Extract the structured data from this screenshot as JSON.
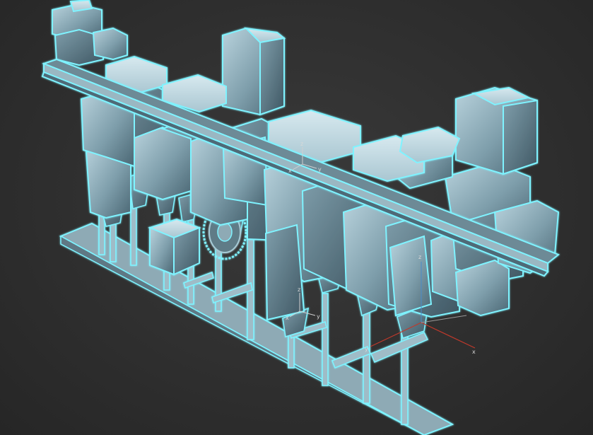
{
  "viewport": {
    "background": "#2e2e2e",
    "selection_color": "#7ff3ff",
    "mesh_color": "#8fb2c0"
  },
  "gizmos": [
    {
      "name": "pivot-top",
      "labels": [
        "z",
        "x",
        "y"
      ]
    },
    {
      "name": "pivot-bottom",
      "labels": [
        "z",
        "x",
        "y"
      ]
    },
    {
      "name": "pivot-right",
      "labels": [
        "z",
        "x",
        "y"
      ]
    }
  ],
  "world_axis": {
    "x_color": "#c0392b",
    "y_color": "#9a9a9a",
    "z_color": "#4a8cc9"
  }
}
